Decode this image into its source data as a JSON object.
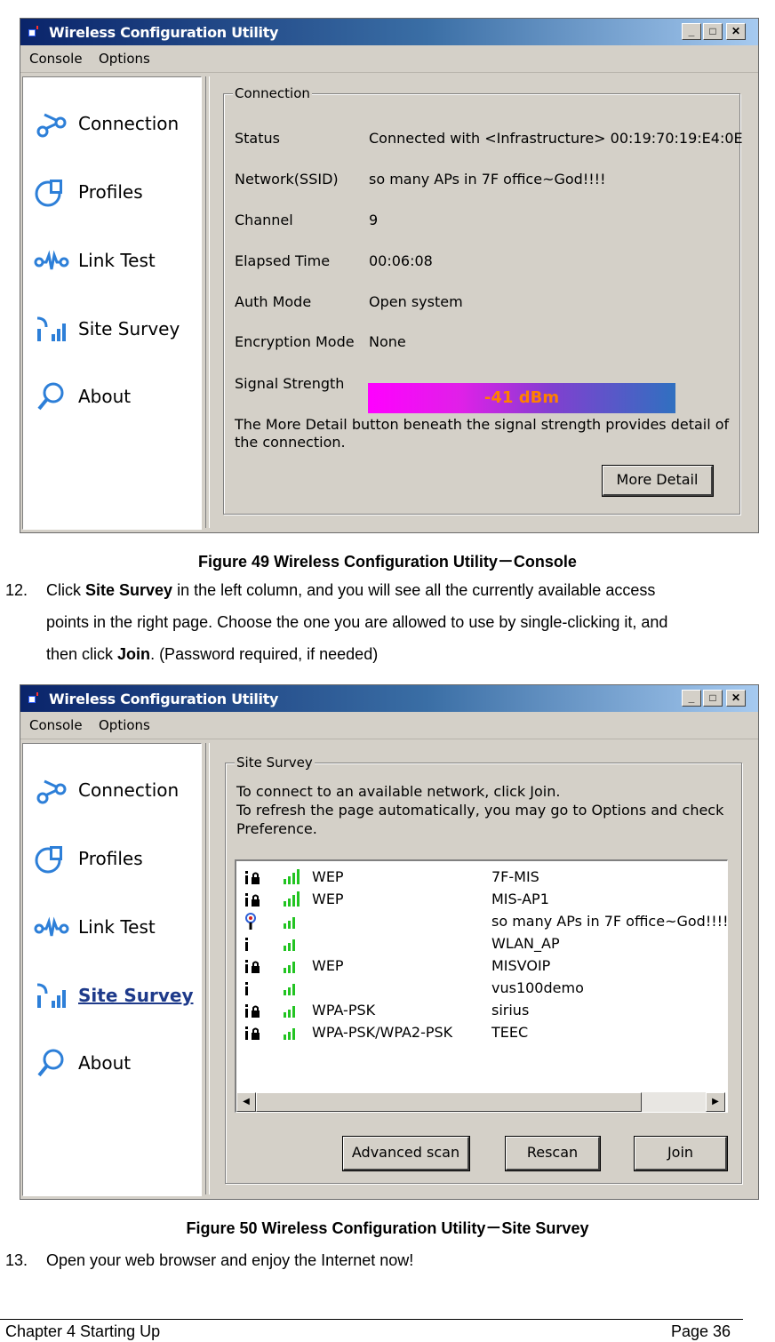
{
  "window1": {
    "title": "Wireless Configuration Utility",
    "menu": [
      "Console",
      "Options"
    ],
    "nav": [
      {
        "label": "Connection",
        "icon": "connection-icon",
        "active": true
      },
      {
        "label": "Profiles",
        "icon": "profiles-icon",
        "active": false
      },
      {
        "label": "Link Test",
        "icon": "link-test-icon",
        "active": false
      },
      {
        "label": "Site Survey",
        "icon": "site-survey-icon",
        "active": false
      },
      {
        "label": "About",
        "icon": "about-icon",
        "active": false
      }
    ],
    "group_title": "Connection",
    "rows": [
      {
        "label": "Status",
        "value": "Connected with <Infrastructure> 00:19:70:19:E4:0E"
      },
      {
        "label": "Network(SSID)",
        "value": "so many APs in 7F office~God!!!!"
      },
      {
        "label": "Channel",
        "value": "9"
      },
      {
        "label": "Elapsed Time",
        "value": "00:06:08"
      },
      {
        "label": "Auth Mode",
        "value": "Open system"
      },
      {
        "label": "Encryption Mode",
        "value": "None"
      }
    ],
    "signal_label": "Signal Strength",
    "signal_value": "-41 dBm",
    "detail_line1": "The More Detail button beneath the signal strength provides detail of",
    "detail_line2": "the connection.",
    "more_detail_button": "More Detail"
  },
  "caption1": "Figure 49 Wireless Configuration Utility－Console",
  "step12": {
    "number": "12.",
    "line1_pre": "Click ",
    "line1_bold": "Site Survey",
    "line1_post": " in the left column, and you will see all the currently available access",
    "line2": "points in the right page. Choose the one you are allowed to use by single-clicking it, and",
    "line3_pre": "then click ",
    "line3_bold": "Join",
    "line3_post": ". (Password required, if needed)"
  },
  "window2": {
    "title": "Wireless Configuration Utility",
    "menu": [
      "Console",
      "Options"
    ],
    "nav": [
      {
        "label": "Connection",
        "icon": "connection-icon",
        "active": false
      },
      {
        "label": "Profiles",
        "icon": "profiles-icon",
        "active": false
      },
      {
        "label": "Link Test",
        "icon": "link-test-icon",
        "active": false
      },
      {
        "label": "Site Survey",
        "icon": "site-survey-icon",
        "active": true
      },
      {
        "label": "About",
        "icon": "about-icon",
        "active": false
      }
    ],
    "group_title": "Site Survey",
    "instructions": [
      "To connect to an available network, click Join.",
      "To refresh the page automatically, you may go to Options and check",
      "Preference."
    ],
    "networks": [
      {
        "type": "infrastructure-locked",
        "signal": "high",
        "encryption": "WEP",
        "ssid": "7F-MIS"
      },
      {
        "type": "infrastructure-locked",
        "signal": "high",
        "encryption": "WEP",
        "ssid": "MIS-AP1"
      },
      {
        "type": "connected",
        "signal": "medium",
        "encryption": "",
        "ssid": "so many APs in 7F office~God!!!!"
      },
      {
        "type": "infrastructure",
        "signal": "medium",
        "encryption": "",
        "ssid": "WLAN_AP"
      },
      {
        "type": "infrastructure-locked",
        "signal": "medium",
        "encryption": "WEP",
        "ssid": "MISVOIP"
      },
      {
        "type": "infrastructure",
        "signal": "medium",
        "encryption": "",
        "ssid": "vus100demo"
      },
      {
        "type": "infrastructure-locked",
        "signal": "medium",
        "encryption": "WPA-PSK",
        "ssid": "sirius"
      },
      {
        "type": "infrastructure-locked",
        "signal": "medium",
        "encryption": "WPA-PSK/WPA2-PSK",
        "ssid": "TEEC"
      }
    ],
    "buttons": {
      "advanced_scan": "Advanced scan",
      "rescan": "Rescan",
      "join": "Join"
    }
  },
  "caption2": "Figure 50 Wireless Configuration Utility－Site Survey",
  "step13": {
    "number": "13.",
    "text": "Open your web browser and enjoy the Internet now!"
  },
  "footer": {
    "left": "Chapter 4 Starting Up",
    "right": "Page 36"
  },
  "colors": {
    "title_gradient_start": "#0a246a",
    "title_gradient_end": "#a6caf0",
    "active_nav": "#1e3a8a",
    "signal_text": "#ff8000",
    "signal_green": "#22c422"
  }
}
